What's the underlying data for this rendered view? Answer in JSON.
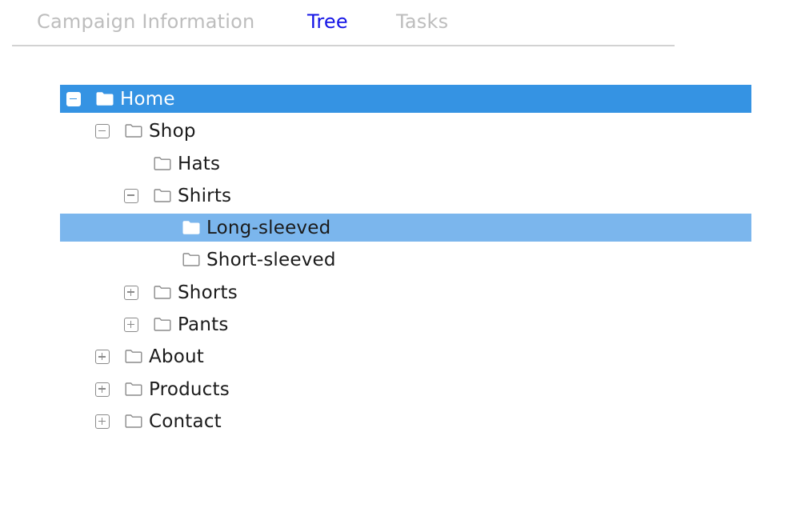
{
  "tabs": [
    {
      "label": "Campaign Information",
      "active": false
    },
    {
      "label": "Tree",
      "active": true
    },
    {
      "label": "Tasks",
      "active": false
    }
  ],
  "tree": {
    "nodes": [
      {
        "label": "Home",
        "depth": 0,
        "expander": "collapse",
        "icon": "folder-filled-icon",
        "state": "selected"
      },
      {
        "label": "Shop",
        "depth": 1,
        "expander": "collapse",
        "icon": "folder-outline-icon",
        "state": "normal"
      },
      {
        "label": "Hats",
        "depth": 2,
        "expander": "none",
        "icon": "folder-outline-icon",
        "state": "normal"
      },
      {
        "label": "Shirts",
        "depth": 2,
        "expander": "collapse",
        "icon": "folder-outline-icon",
        "state": "normal"
      },
      {
        "label": "Long-sleeved",
        "depth": 3,
        "expander": "none",
        "icon": "folder-filled-icon",
        "state": "highlighted"
      },
      {
        "label": "Short-sleeved",
        "depth": 3,
        "expander": "none",
        "icon": "folder-outline-icon",
        "state": "normal"
      },
      {
        "label": "Shorts",
        "depth": 2,
        "expander": "expand",
        "icon": "folder-outline-icon",
        "state": "normal"
      },
      {
        "label": "Pants",
        "depth": 2,
        "expander": "expand",
        "icon": "folder-outline-icon",
        "state": "normal"
      },
      {
        "label": "About",
        "depth": 1,
        "expander": "expand",
        "icon": "folder-outline-icon",
        "state": "normal"
      },
      {
        "label": "Products",
        "depth": 1,
        "expander": "expand",
        "icon": "folder-outline-icon",
        "state": "normal"
      },
      {
        "label": "Contact",
        "depth": 1,
        "expander": "expand",
        "icon": "folder-outline-icon",
        "state": "normal"
      }
    ]
  },
  "colors": {
    "tab_active": "#1414e6",
    "tab_inactive": "#bdbdbd",
    "selected_row": "#3593e3",
    "highlighted_row": "#7bb6ed",
    "text": "#1b1b1b"
  }
}
